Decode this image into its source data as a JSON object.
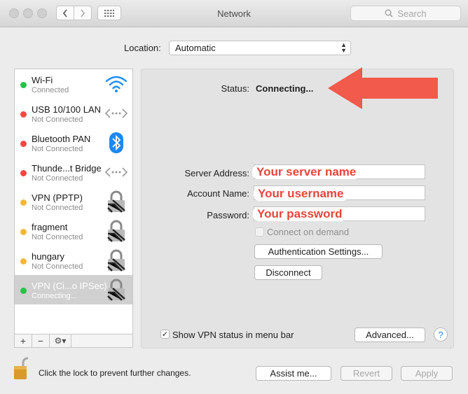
{
  "window": {
    "title": "Network"
  },
  "search": {
    "placeholder": "Search"
  },
  "location": {
    "label": "Location:",
    "value": "Automatic"
  },
  "services": [
    {
      "name": "Wi-Fi",
      "status": "Connected",
      "dot": "#29c14a",
      "icon": "wifi-icon"
    },
    {
      "name": "USB 10/100 LAN",
      "status": "Not Connected",
      "dot": "#f04a43",
      "icon": "ethernet-icon"
    },
    {
      "name": "Bluetooth PAN",
      "status": "Not Connected",
      "dot": "#f04a43",
      "icon": "bluetooth-icon"
    },
    {
      "name": "Thunde...t Bridge",
      "status": "Not Connected",
      "dot": "#f04a43",
      "icon": "ethernet-icon"
    },
    {
      "name": "VPN (PPTP)",
      "status": "Not Connected",
      "dot": "#f6b73c",
      "icon": "vpn-lock-icon"
    },
    {
      "name": "fragment",
      "status": "Not Connected",
      "dot": "#f6b73c",
      "icon": "vpn-lock-icon"
    },
    {
      "name": "hungary",
      "status": "Not Connected",
      "dot": "#f6b73c",
      "icon": "vpn-lock-icon"
    },
    {
      "name": "VPN (Ci...o IPSec)",
      "status": "Connecting...",
      "dot": "#29c14a",
      "icon": "vpn-lock-icon",
      "selected": true
    }
  ],
  "toolbar": {
    "add": "+",
    "remove": "−",
    "gear": "⚙▾"
  },
  "status": {
    "label": "Status:",
    "value": "Connecting..."
  },
  "form": {
    "server_label": "Server Address:",
    "server_overlay": "Your server name",
    "account_label": "Account Name:",
    "account_overlay": "Your username",
    "password_label": "Password:",
    "password_overlay": "Your password",
    "connect_on_demand": "Connect on demand",
    "auth_button": "Authentication Settings...",
    "disconnect_button": "Disconnect"
  },
  "show_vpn_status": {
    "label": "Show VPN status in menu bar",
    "checked": true
  },
  "advanced_button": "Advanced...",
  "help_button": "?",
  "footer": {
    "lock_text": "Click the lock to prevent further changes.",
    "assist": "Assist me...",
    "revert": "Revert",
    "apply": "Apply"
  },
  "colors": {
    "annotation": "#f25a4b",
    "selection": "#d0d0d0"
  }
}
